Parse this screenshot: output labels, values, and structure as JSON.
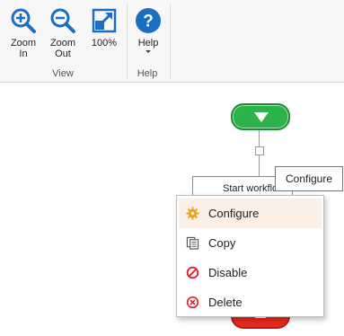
{
  "ribbon": {
    "view_group": {
      "label": "View",
      "buttons": [
        {
          "line1": "Zoom",
          "line2": "In",
          "icon": "zoom-in-icon"
        },
        {
          "line1": "Zoom",
          "line2": "Out",
          "icon": "zoom-out-icon"
        },
        {
          "line1": "100%",
          "line2": "",
          "icon": "actual-size-icon"
        }
      ]
    },
    "help_group": {
      "label": "Help",
      "button": {
        "label": "Help",
        "icon": "help-icon"
      }
    }
  },
  "canvas": {
    "start_node_icon": "play-down-arrow-icon",
    "action_box_text": "Start workflow",
    "end_node_icon": "stop-square-icon"
  },
  "tooltip": {
    "text": "Configure"
  },
  "context_menu": {
    "items": [
      {
        "label": "Configure",
        "icon": "gear-icon",
        "highlighted": true
      },
      {
        "label": "Copy",
        "icon": "copy-icon",
        "highlighted": false
      },
      {
        "label": "Disable",
        "icon": "disable-icon",
        "highlighted": false
      },
      {
        "label": "Delete",
        "icon": "delete-icon",
        "highlighted": false
      }
    ]
  },
  "colors": {
    "ribbon_icon_blue": "#1b6ec2",
    "start_green": "#2db34a",
    "end_red": "#e8291c",
    "menu_highlight": "#fcefe6",
    "gear_yellow": "#e3a21a",
    "danger_red": "#d8282b"
  }
}
